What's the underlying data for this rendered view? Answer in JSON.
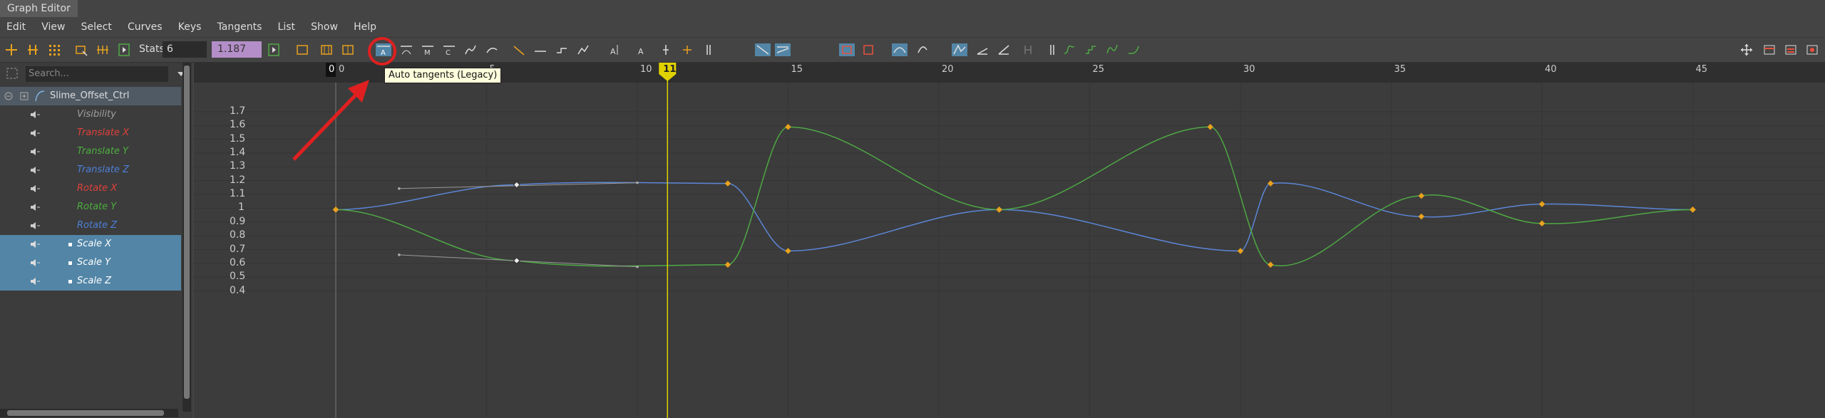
{
  "window": {
    "title": "Graph Editor"
  },
  "menu": [
    "Edit",
    "View",
    "Select",
    "Curves",
    "Keys",
    "Tangents",
    "List",
    "Show",
    "Help"
  ],
  "toolbar": {
    "stats_label": "Stats",
    "stats_value": "6",
    "value_field": "1.187"
  },
  "outliner": {
    "search_placeholder": "Search...",
    "object": "Slime_Offset_Ctrl",
    "channels": [
      {
        "label": "Visibility",
        "color": "#a0a0a0",
        "selected": false
      },
      {
        "label": "Translate X",
        "color": "#e0413c",
        "selected": false
      },
      {
        "label": "Translate Y",
        "color": "#4cae3e",
        "selected": false
      },
      {
        "label": "Translate Z",
        "color": "#4c7fd8",
        "selected": false
      },
      {
        "label": "Rotate X",
        "color": "#e0413c",
        "selected": false
      },
      {
        "label": "Rotate Y",
        "color": "#4cae3e",
        "selected": false
      },
      {
        "label": "Rotate Z",
        "color": "#4c7fd8",
        "selected": false
      },
      {
        "label": "Scale X",
        "color": "#ffffff",
        "selected": true
      },
      {
        "label": "Scale Y",
        "color": "#ffffff",
        "selected": true
      },
      {
        "label": "Scale Z",
        "color": "#ffffff",
        "selected": true
      }
    ]
  },
  "graph": {
    "current_frame": "11",
    "frame_ticks": [
      "0",
      "5",
      "10",
      "15",
      "20",
      "25",
      "30",
      "35",
      "40",
      "45"
    ],
    "value_ticks": [
      "1.7",
      "1.6",
      "1.5",
      "1.4",
      "1.3",
      "1.2",
      "1.1",
      "1",
      "0.9",
      "0.8",
      "0.7",
      "0.6",
      "0.5",
      "0.4"
    ],
    "tooltip": "Auto tangents (Legacy)",
    "colors": {
      "blue_curve": "#5b86d6",
      "green_curve": "#4ea844",
      "key": "#e8a21e",
      "current_time": "#e0d200"
    }
  }
}
